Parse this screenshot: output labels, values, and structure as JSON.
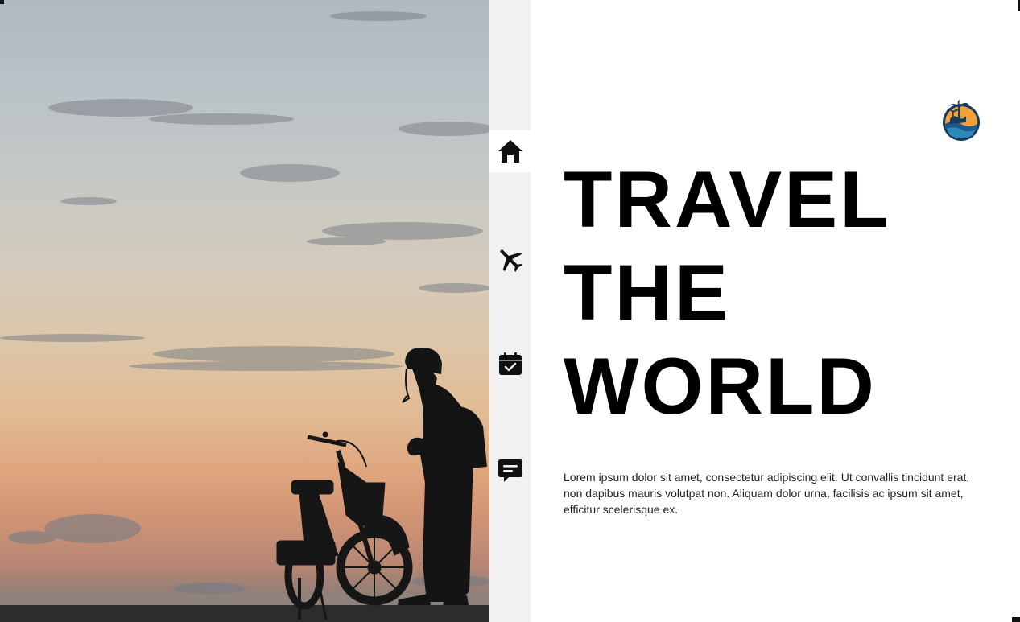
{
  "hero": {
    "image": "sunset-cyclist-photo"
  },
  "nav": {
    "items": [
      {
        "icon": "home-icon",
        "active": true
      },
      {
        "icon": "airplane-icon",
        "active": false
      },
      {
        "icon": "calendar-check-icon",
        "active": false
      },
      {
        "icon": "chat-icon",
        "active": false
      }
    ]
  },
  "content": {
    "logo_icon": "palm-island-logo",
    "headline": [
      "TRAVEL",
      "THE",
      "WORLD"
    ],
    "body": "Lorem ipsum dolor sit amet, consectetur adipiscing elit. Ut convallis tincidunt erat, non dapibus mauris volutpat non. Aliquam dolor urna, facilisis ac ipsum sit amet, efficitur scelerisque ex."
  },
  "colors": {
    "rail_bg": "#f1f1f1",
    "text": "#000000",
    "logo_navy": "#173b5e",
    "logo_orange": "#f2a03a"
  }
}
